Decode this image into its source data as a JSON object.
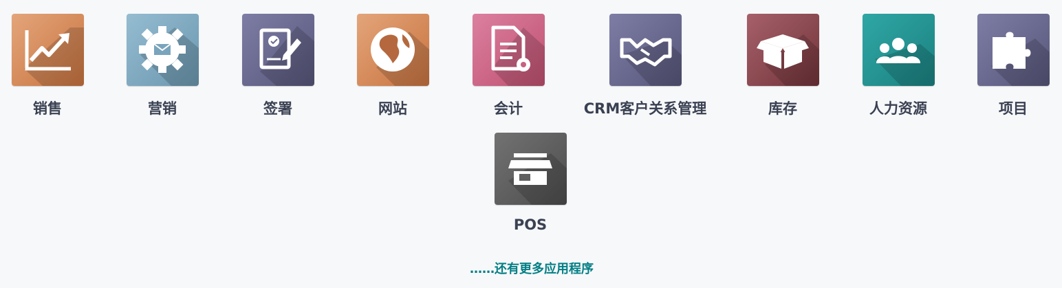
{
  "apps": [
    {
      "label": "销售",
      "icon": "sales-chart-icon",
      "colors": [
        "#cf7b48",
        "#e0a070"
      ]
    },
    {
      "label": "营销",
      "icon": "gear-envelope-icon",
      "colors": [
        "#6e9bb3",
        "#8fb6cc"
      ]
    },
    {
      "label": "签署",
      "icon": "document-signature-icon",
      "colors": [
        "#5d5c7d",
        "#7a79a0"
      ]
    },
    {
      "label": "网站",
      "icon": "globe-icon",
      "colors": [
        "#cf7b48",
        "#e0a070"
      ]
    },
    {
      "label": "会计",
      "icon": "invoice-gear-icon",
      "colors": [
        "#c05674",
        "#d9789a"
      ]
    },
    {
      "label": "CRM客户关系管理",
      "icon": "handshake-icon",
      "colors": [
        "#5d5c7d",
        "#7a79a0"
      ]
    },
    {
      "label": "库存",
      "icon": "box-icon",
      "colors": [
        "#7d3b41",
        "#a25a62"
      ]
    },
    {
      "label": "人力资源",
      "icon": "people-icon",
      "colors": [
        "#1c8483",
        "#2aa3a1"
      ]
    },
    {
      "label": "项目",
      "icon": "puzzle-icon",
      "colors": [
        "#5d5c7d",
        "#7a79a0"
      ]
    },
    {
      "label": "POS",
      "icon": "store-icon",
      "colors": [
        "#545454",
        "#6d6d6d"
      ]
    }
  ],
  "more_link": "……还有更多应用程序"
}
